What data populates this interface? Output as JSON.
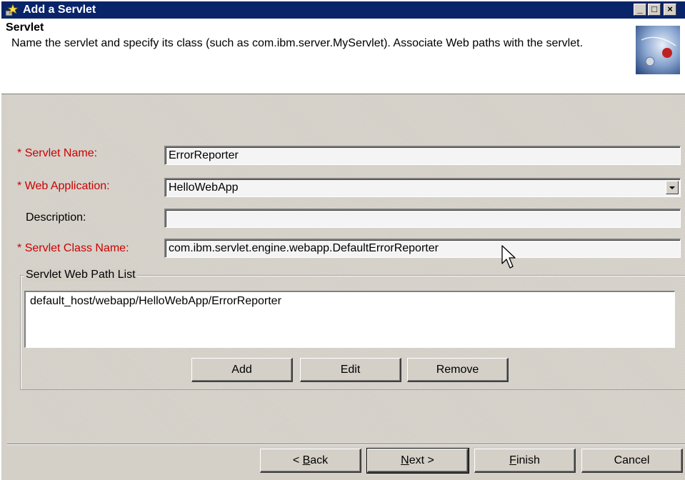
{
  "window": {
    "title": "Add a Servlet",
    "controls": {
      "minimize": "_",
      "maximize": "□",
      "close": "×"
    }
  },
  "header": {
    "title": "Servlet",
    "description": "Name the servlet and specify its class (such as com.ibm.server.MyServlet). Associate Web paths with the servlet."
  },
  "form": {
    "servlet_name": {
      "label": "Servlet Name:",
      "value": "ErrorReporter",
      "required": true
    },
    "web_application": {
      "label": "Web Application:",
      "value": "HelloWebApp",
      "required": true
    },
    "description": {
      "label": "Description:",
      "value": "",
      "required": false
    },
    "servlet_class_name": {
      "label": "Servlet Class Name:",
      "value": "com.ibm.servlet.engine.webapp.DefaultErrorReporter",
      "required": true
    },
    "required_marker": "*"
  },
  "web_path_list": {
    "legend": "Servlet Web Path List",
    "items": [
      "default_host/webapp/HelloWebApp/ErrorReporter"
    ],
    "buttons": {
      "add": "Add",
      "edit": "Edit",
      "remove": "Remove"
    }
  },
  "footer": {
    "back": {
      "prefix": "< ",
      "mnemonic": "B",
      "rest": "ack"
    },
    "next": {
      "mnemonic": "N",
      "rest": "ext >"
    },
    "finish": {
      "mnemonic": "F",
      "rest": "inish"
    },
    "cancel": "Cancel"
  },
  "colors": {
    "titlebar": "#0a246a",
    "required_label": "#cc0000",
    "dialog_bg": "#d4d0c8"
  },
  "icons": [
    "servlet-app-icon",
    "wizard-graphic-icon",
    "dropdown-arrow-icon",
    "mouse-cursor-icon"
  ]
}
